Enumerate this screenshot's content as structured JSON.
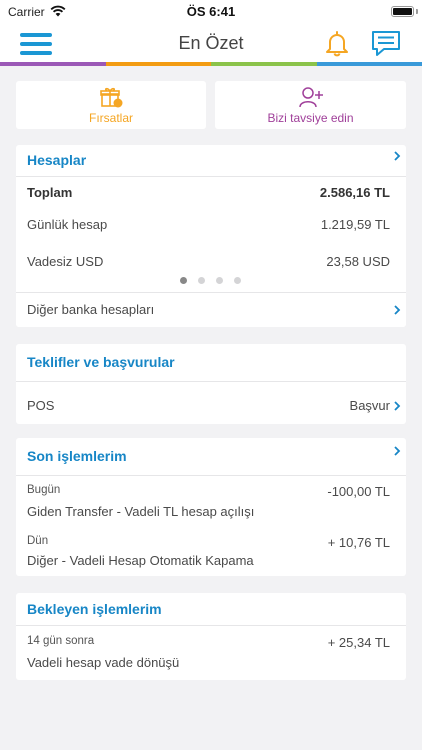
{
  "status_bar": {
    "carrier": "Carrier",
    "time": "ÖS 6:41",
    "battery_level": 1.0
  },
  "nav": {
    "title": "En Özet",
    "menu_icon": "hamburger-menu-icon",
    "notification_icon": "bell-icon",
    "chat_icon": "chat-bubble-icon"
  },
  "stripe_colors": [
    "#9b59b6",
    "#f39c12",
    "#8bc34a",
    "#3a9ad9"
  ],
  "quick_actions": [
    {
      "label": "Fırsatlar",
      "icon": "gift-icon",
      "color": "#f5a623"
    },
    {
      "label": "Bizi tavsiye edin",
      "icon": "add-person-icon",
      "color": "#a0409a"
    }
  ],
  "accounts": {
    "title": "Hesaplar",
    "total_label": "Toplam",
    "total_value": "2.586,16 TL",
    "rows": [
      {
        "label": "Günlük hesap",
        "value": "1.219,59 TL"
      },
      {
        "label": "Vadesiz USD",
        "value": "23,58 USD"
      }
    ],
    "page_count": 4,
    "active_page": 1,
    "other_banks_label": "Diğer banka hesapları"
  },
  "offers": {
    "title": "Teklifler ve başvurular",
    "item_label": "POS",
    "action_label": "Başvur"
  },
  "transactions": {
    "title": "Son işlemlerim",
    "items": [
      {
        "date": "Bugün",
        "description": "Giden Transfer - Vadeli TL hesap açılışı",
        "amount": "-100,00 TL"
      },
      {
        "date": "Dün",
        "description": "Diğer - Vadeli Hesap Otomatik Kapama",
        "amount": "+ 10,76 TL"
      }
    ]
  },
  "pending": {
    "title": "Bekleyen işlemlerim",
    "items": [
      {
        "when": "14 gün sonra",
        "description": "Vadeli hesap vade dönüşü",
        "amount": "+ 25,34 TL"
      }
    ]
  },
  "colors": {
    "accent": "#1786c6",
    "background": "#f2f2f4",
    "bell": "#f5a623"
  }
}
